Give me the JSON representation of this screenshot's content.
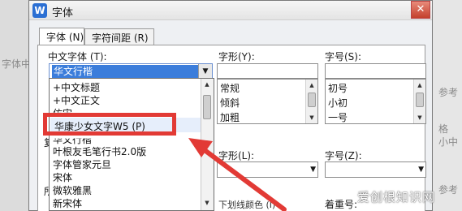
{
  "dialog": {
    "title": "字体",
    "app_icon": "W",
    "close_glyph": "✕"
  },
  "tabs": [
    {
      "label": "字体 (N)",
      "active": true
    },
    {
      "label": "字符间距 (R)",
      "active": false
    }
  ],
  "sections": {
    "chinese_font_label": "中文字体 (T):",
    "style_label": "字形(Y):",
    "size_label": "字号(S):",
    "style_label_2": "字形(L):",
    "size_label_2": "字号(Z):",
    "emphasis_label": "着重号:",
    "underline_color_label": "下划线颜色 (I)"
  },
  "chinese_font_combo": {
    "value": "华文行楷"
  },
  "style_list": {
    "input_value": "",
    "items": [
      "常规",
      "倾斜",
      "加粗"
    ]
  },
  "size_list": {
    "input_value": "",
    "items": [
      "初号",
      "小初",
      "一号"
    ]
  },
  "font_dropdown": {
    "items": [
      "+中文标题",
      "+中文正文",
      "仿宋",
      "华康少女文字W5 (P)",
      "华文行楷",
      "叶根友毛笔行书2.0版",
      "字体管家元旦",
      "宋体",
      "微软雅黑",
      "新宋体"
    ]
  },
  "partial_labels": {
    "left_1": "复",
    "left_2": "所",
    "bg_left": "字体中",
    "bg_right_1": "参考",
    "bg_right_2": "格",
    "bg_right_3": "小中",
    "bg_right_4": "参考"
  },
  "watermark": "爱创根知识网",
  "colors": {
    "highlight": "#3b7ddb",
    "annotation_red": "#e23a35"
  }
}
